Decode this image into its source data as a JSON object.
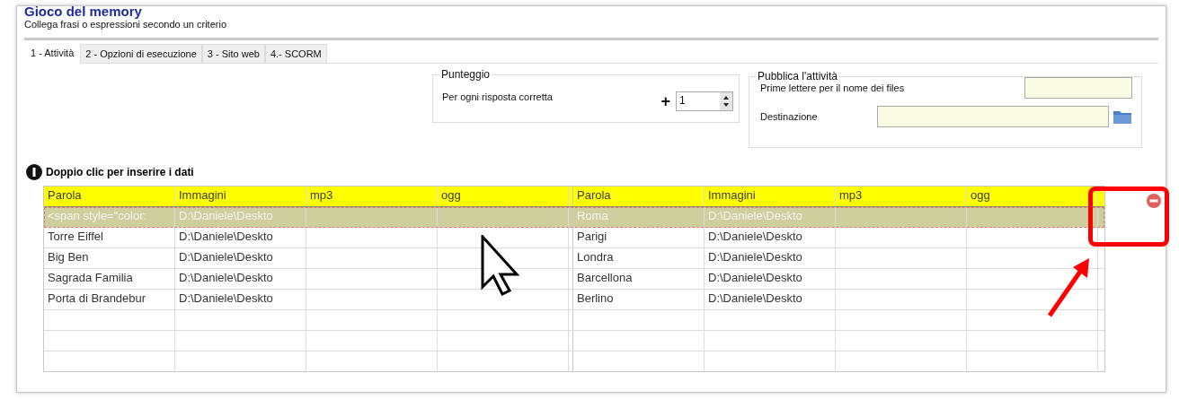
{
  "header": {
    "title": "Gioco del memory",
    "subtitle": "Collega frasi o espressioni secondo un criterio"
  },
  "tabs": [
    {
      "label": "1 - Attività",
      "selected": true
    },
    {
      "label": "2 - Opzioni di esecuzione",
      "selected": false
    },
    {
      "label": "3 - Sito web",
      "selected": false
    },
    {
      "label": "4.-  SCORM",
      "selected": false
    }
  ],
  "score_group": {
    "title": "Punteggio",
    "label": "Per ogni risposta corretta",
    "plus": "+",
    "value": "1"
  },
  "publish_group": {
    "title": "Pubblica l'attività",
    "prefix_label": "Prime lettere per il nome dei files",
    "destination_label": "Destinazione"
  },
  "hint": "Doppio clic per inserire i dati",
  "table": {
    "columns": [
      "Parola",
      "Immagini",
      "mp3",
      "ogg",
      "Parola",
      "Immagini",
      "mp3",
      "ogg"
    ],
    "rows": [
      {
        "selected": true,
        "parola": "<span style=\"color:",
        "immagini": "D:\\Daniele\\Deskto",
        "parola_2": "Roma",
        "immagini_2": "D:\\Daniele\\Deskto"
      },
      {
        "selected": false,
        "parola": "Torre Eiffel",
        "immagini": "D:\\Daniele\\Deskto",
        "parola_2": "Parigi",
        "immagini_2": "D:\\Daniele\\Deskto"
      },
      {
        "selected": false,
        "parola": "Big Ben",
        "immagini": "D:\\Daniele\\Deskto",
        "parola_2": "Londra",
        "immagini_2": "D:\\Daniele\\Deskto"
      },
      {
        "selected": false,
        "parola": "Sagrada Familia",
        "immagini": "D:\\Daniele\\Deskto",
        "parola_2": "Barcellona",
        "immagini_2": "D:\\Daniele\\Deskto"
      },
      {
        "selected": false,
        "parola": "Porta di Brandebur",
        "immagini": "D:\\Daniele\\Deskto",
        "parola_2": "Berlino",
        "immagini_2": "D:\\Daniele\\Deskto"
      }
    ]
  }
}
